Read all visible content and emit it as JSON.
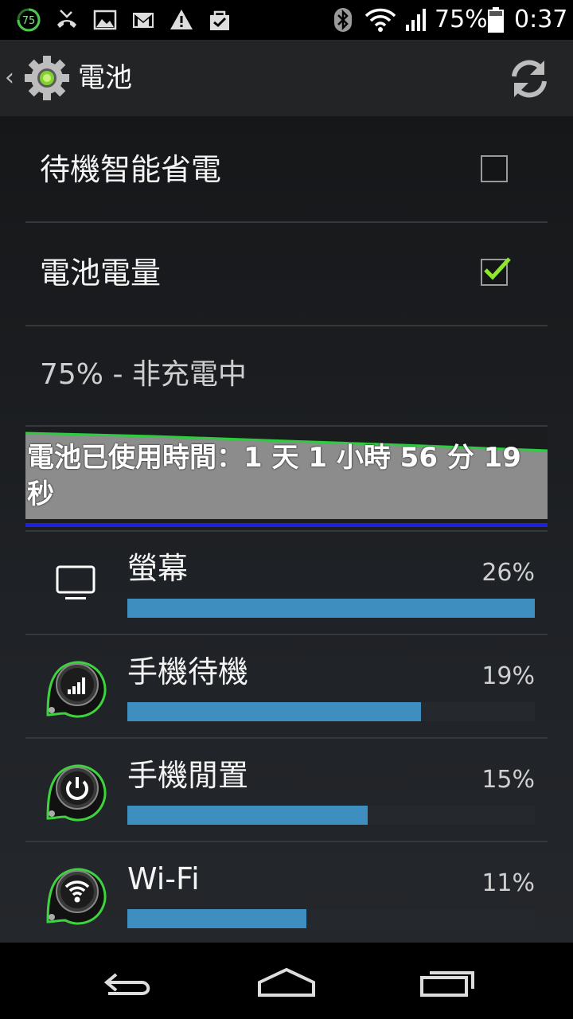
{
  "status_bar": {
    "battery_level": "75%",
    "time": "0:37",
    "notification_icons": [
      "battery-75-circle-icon",
      "missed-call-icon",
      "image-icon",
      "gmail-icon",
      "warning-icon",
      "shopping-bag-icon"
    ],
    "system_icons": [
      "bluetooth-icon",
      "wifi-icon",
      "signal-icon",
      "battery-icon"
    ],
    "notification_badge": "75"
  },
  "action_bar": {
    "title": "電池",
    "icons": [
      "back-caret-icon",
      "settings-gear-icon",
      "refresh-icon"
    ]
  },
  "preferences": [
    {
      "label": "待機智能省電",
      "checked": false
    },
    {
      "label": "電池電量",
      "checked": true
    }
  ],
  "battery_status": "75% - 非充電中",
  "battery_graph": {
    "usage_time_text": "電池已使用時間：1 天 1 小時 56 分 19 秒",
    "line_color": "#2ecc40",
    "fill_color": "#8c8c8c",
    "indicator_color": "#1f1fe0"
  },
  "usage": [
    {
      "name": "螢幕",
      "percent_text": "26%",
      "fraction": 1.0,
      "icon": "screen-icon"
    },
    {
      "name": "手機待機",
      "percent_text": "19%",
      "fraction": 0.72,
      "icon": "cell-standby-icon"
    },
    {
      "name": "手機閒置",
      "percent_text": "15%",
      "fraction": 0.59,
      "icon": "phone-idle-power-icon"
    },
    {
      "name": "Wi-Fi",
      "percent_text": "11%",
      "fraction": 0.44,
      "icon": "wifi-usage-icon"
    }
  ],
  "nav_bar": {
    "icons": [
      "back-icon",
      "home-icon",
      "recent-apps-icon"
    ]
  },
  "colors": {
    "bar_fill": "#3e8fc0",
    "accent_green": "#3fd23f"
  }
}
